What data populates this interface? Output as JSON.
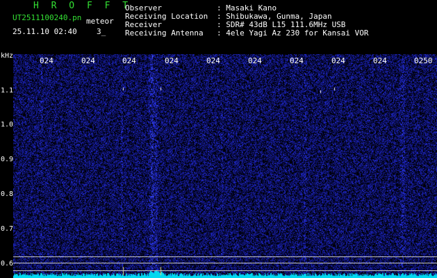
{
  "header": {
    "brand": "H R O F F T",
    "filename": "UT2511100240.pn",
    "mode": "meteor",
    "datetime": "25.11.10 02:40",
    "count": "3_",
    "labels": [
      "Observer",
      "Receiving Location",
      "Receiver",
      "Receiving Antenna"
    ],
    "values": [
      ": Masaki Kano",
      ": Shibukawa, Gunma, Japan",
      ": SDR# 43dB L15 111.6MHz USB",
      ": 4ele Yagi Az 230 for Kansai VOR"
    ]
  },
  "axis": {
    "unit": "kHz",
    "y_ticks": [
      "1.1",
      "1.0",
      "0.9",
      "0.8",
      "0.7",
      "0.6"
    ],
    "x_ticks": [
      "024",
      "024",
      "024",
      "024",
      "024",
      "024",
      "024",
      "024",
      "024",
      "0250"
    ]
  },
  "colors": {
    "background": "#000000",
    "noise": "#1a22c8",
    "baseline": "#00e5ff",
    "header_green": "#33e033"
  }
}
